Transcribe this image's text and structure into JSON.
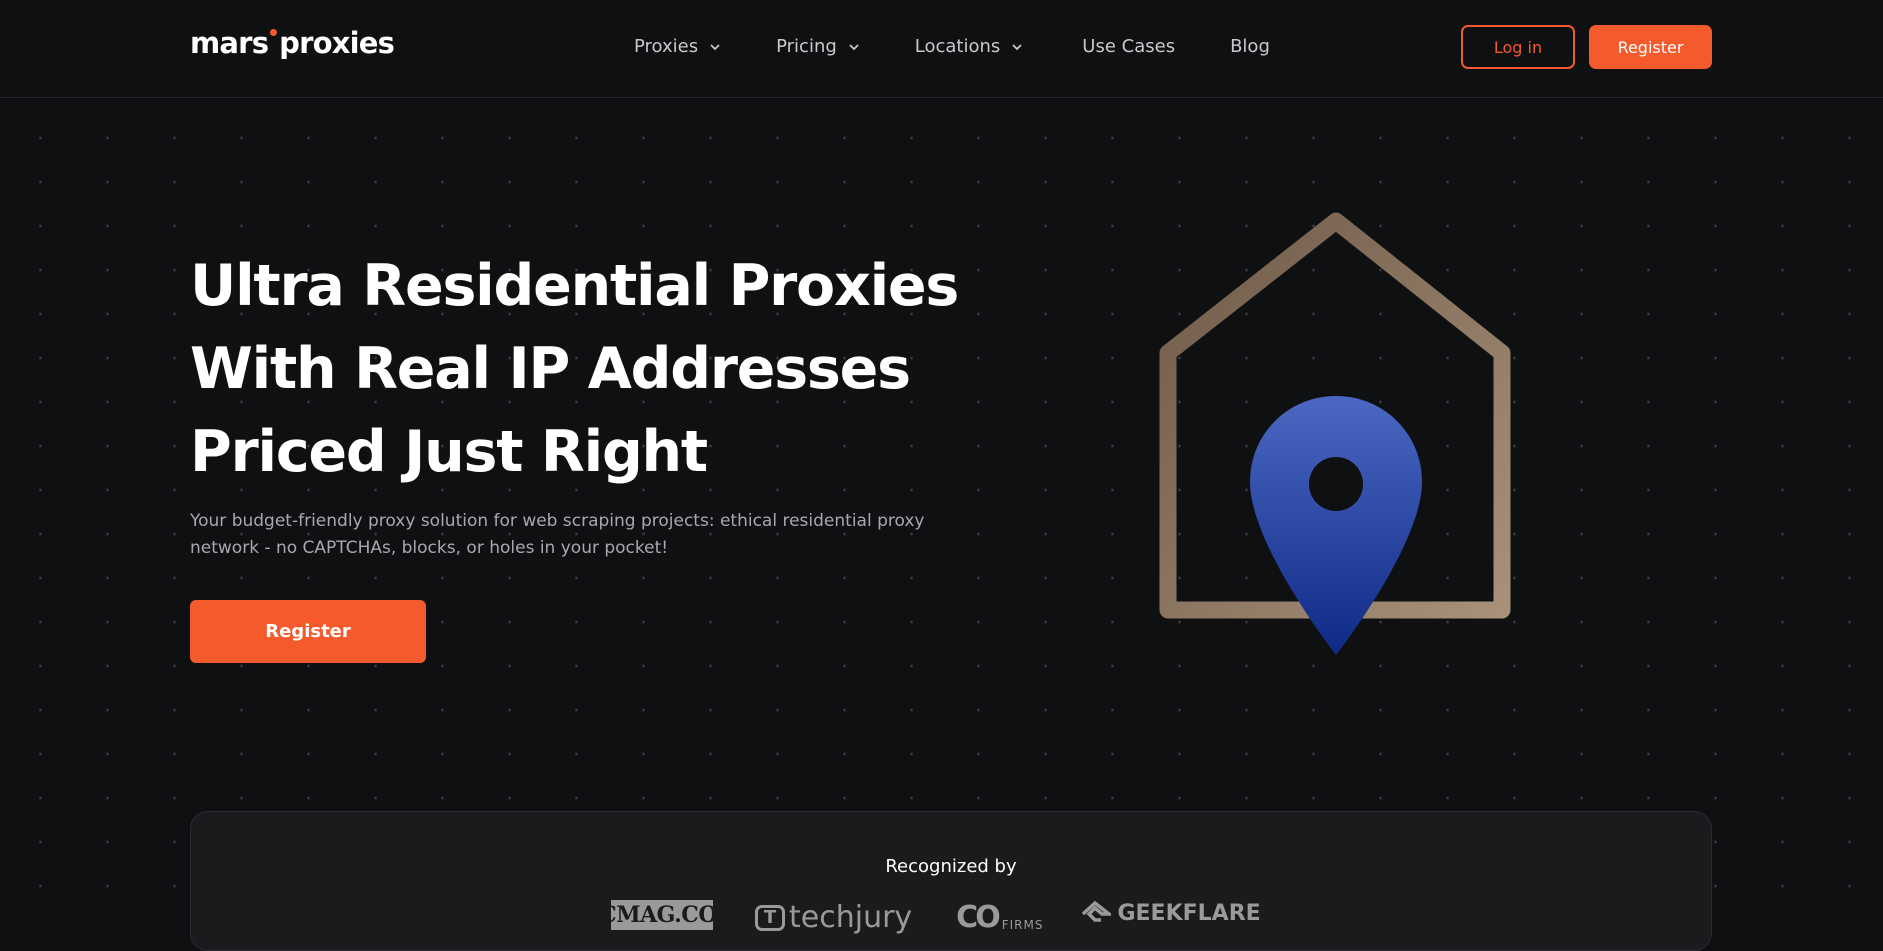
{
  "header": {
    "logo": {
      "left": "mars",
      "right": "proxies"
    },
    "nav": [
      {
        "label": "Proxies",
        "has_dropdown": true
      },
      {
        "label": "Pricing",
        "has_dropdown": true
      },
      {
        "label": "Locations",
        "has_dropdown": true
      },
      {
        "label": "Use Cases",
        "has_dropdown": false
      },
      {
        "label": "Blog",
        "has_dropdown": false
      }
    ],
    "login_label": "Log in",
    "register_label": "Register"
  },
  "hero": {
    "title_lines": [
      "Ultra Residential Proxies",
      "With Real IP Addresses",
      "Priced Just Right"
    ],
    "subtitle": "Your budget-friendly proxy solution for web scraping projects: ethical residential proxy network - no CAPTCHAs, blocks, or holes in your pocket!",
    "cta_label": "Register",
    "illustration_icon": "house-location-pin-icon"
  },
  "recognized": {
    "title": "Recognized by",
    "logos": [
      {
        "name": "pcmag-logo",
        "text": "PCMAG.COM"
      },
      {
        "name": "techjury-logo",
        "text": "techjury"
      },
      {
        "name": "cofirms-logo",
        "text": "FIRMS"
      },
      {
        "name": "geekflare-logo",
        "text": "GEEKFLARE"
      }
    ]
  },
  "colors": {
    "accent": "#f45a2b",
    "background": "#0f1012",
    "pin": "#3352b0",
    "house_outline": "#9d8269"
  }
}
